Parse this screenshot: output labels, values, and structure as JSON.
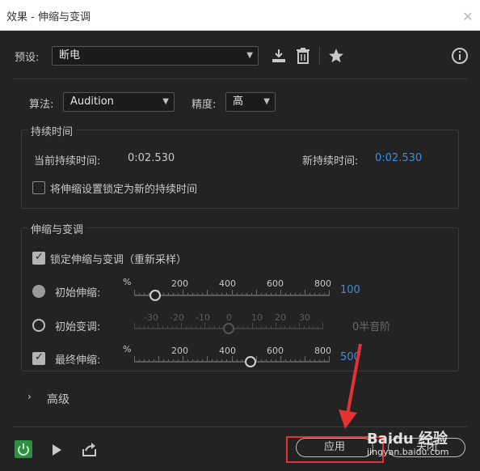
{
  "window": {
    "title": "效果 - 伸缩与变调",
    "close_glyph": "✕"
  },
  "preset": {
    "label": "预设:",
    "value": "断电"
  },
  "algorithm": {
    "label": "算法:",
    "value": "Audition"
  },
  "precision": {
    "label": "精度:",
    "value": "高"
  },
  "duration": {
    "title": "持续时间",
    "current_label": "当前持续时间:",
    "current_value": "0:02.530",
    "new_label": "新持续时间:",
    "new_value": "0:02.530",
    "lock_label": "将伸缩设置锁定为新的持续时间",
    "lock_checked": false
  },
  "stretch_pitch": {
    "title": "伸缩与变调",
    "lock_label": "锁定伸缩与变调（重新采样）",
    "lock_checked": true,
    "initial_stretch": {
      "label": "初始伸缩:",
      "unit": "%",
      "ticks": [
        "200",
        "400",
        "600",
        "800"
      ],
      "value": "100"
    },
    "initial_pitch": {
      "label": "初始变调:",
      "ticks": [
        "-30",
        "-20",
        "-10",
        "0",
        "10",
        "20",
        "30"
      ],
      "value": "0半音阶"
    },
    "final_stretch": {
      "label": "最终伸缩:",
      "unit": "%",
      "ticks": [
        "200",
        "400",
        "600",
        "800"
      ],
      "value": "500"
    }
  },
  "advanced": {
    "label": "高级"
  },
  "footer": {
    "apply_label": "应用",
    "close_label": "关闭"
  },
  "watermark": {
    "line1": "Baidu 经验",
    "line2": "jingyan.baidu.com"
  },
  "colors": {
    "accent": "#3a8ee6",
    "power": "#2e8f44",
    "annotation": "#e23232"
  }
}
